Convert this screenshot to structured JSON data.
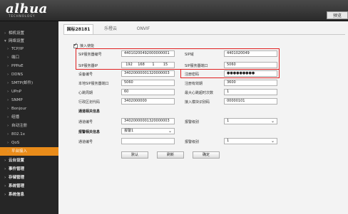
{
  "header": {
    "logo": "alhua",
    "logo_sub": "TECHNOLOGY",
    "preview_tab": "预览"
  },
  "sidebar": {
    "items": [
      {
        "label": "相机设置",
        "level": 0
      },
      {
        "label": "网络设置",
        "level": 0
      },
      {
        "label": "TCP/IP",
        "level": 1
      },
      {
        "label": "端口",
        "level": 1
      },
      {
        "label": "PPPoE",
        "level": 1
      },
      {
        "label": "DDNS",
        "level": 1
      },
      {
        "label": "SMTP(邮件)",
        "level": 1
      },
      {
        "label": "UPnP",
        "level": 1
      },
      {
        "label": "SNMP",
        "level": 1
      },
      {
        "label": "Bonjour",
        "level": 1
      },
      {
        "label": "组播",
        "level": 1
      },
      {
        "label": "自动注册",
        "level": 1
      },
      {
        "label": "802.1x",
        "level": 1
      },
      {
        "label": "QoS",
        "level": 1
      },
      {
        "label": "平台接入",
        "level": 1,
        "active": true
      },
      {
        "label": "云台设置",
        "level": 0
      },
      {
        "label": "事件管理",
        "level": 0
      },
      {
        "label": "存储管理",
        "level": 0
      },
      {
        "label": "系统管理",
        "level": 0
      },
      {
        "label": "系统信息",
        "level": 0
      }
    ]
  },
  "tabs": [
    "国标28181",
    "乐橙云",
    "ONVIF"
  ],
  "form": {
    "enable_label": "接入使能",
    "sip_server_id_label": "SIP服务器编号",
    "sip_server_id": "44010200492000000001",
    "sip_domain_label": "SIP域",
    "sip_domain": "4401020049",
    "sip_server_ip_label": "SIP服务器IP",
    "sip_server_ip": [
      "192",
      "168",
      "1",
      "15"
    ],
    "sip_server_port_label": "SIP服务器端口",
    "sip_server_port": "5060",
    "device_id_label": "设备编号",
    "device_id": "34020000001320000003",
    "register_password_label": "注册密码",
    "register_password": "●●●●●●●●●",
    "local_sip_port_label": "本地SIP服务器端口",
    "local_sip_port": "5060",
    "register_validity_label": "注册有效期",
    "register_validity": "3600",
    "heartbeat_label": "心跳周期",
    "heartbeat": "60",
    "max_timeout_label": "最大心跳超时次数",
    "max_timeout": "1",
    "region_code_label": "行政区划代码",
    "region_code": "3402000000",
    "industry_code_label": "接入模块识别码",
    "industry_code": "00000101",
    "channel_section": "通道相关信息",
    "channel_id_label": "通道编号",
    "channel_id": "34020000001320000003",
    "alarm_level_label": "报警级别",
    "alarm_level": "1",
    "alarm_section": "报警相关信息",
    "alarm_select": "报警1",
    "alarm_channel_label": "通道编号",
    "alarm_channel": "",
    "alarm_level2_label": "报警级别",
    "alarm_level2": "1"
  },
  "buttons": {
    "default": "默认",
    "refresh": "刷新",
    "confirm": "确定"
  },
  "colors": {
    "accent": "#e98c1a",
    "highlight": "#e02020"
  }
}
